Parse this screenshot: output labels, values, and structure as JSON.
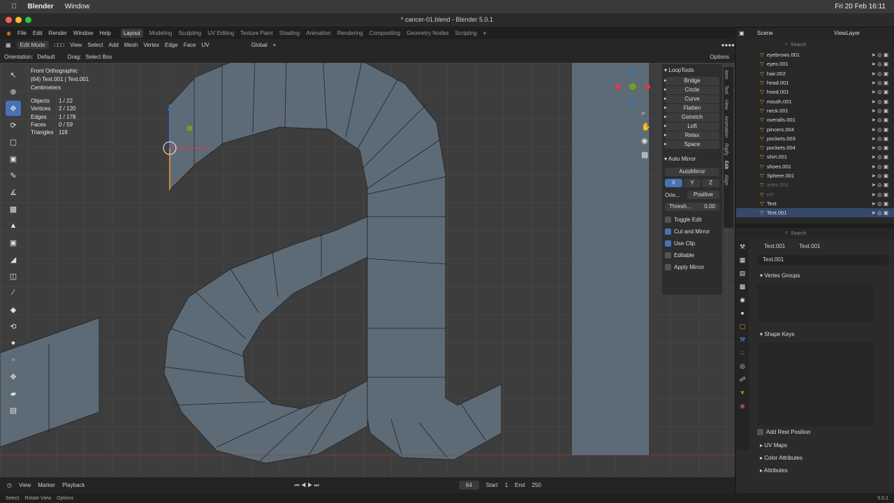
{
  "mac_menu": {
    "app": "Blender",
    "window": "Window",
    "clock": "Fri 20 Feb 16:11"
  },
  "title": "* cancer-01.blend - Blender 5.0.1",
  "menus": [
    "File",
    "Edit",
    "Render",
    "Window",
    "Help"
  ],
  "workspaces": [
    "Layout",
    "Modeling",
    "Sculpting",
    "UV Editing",
    "Texture Paint",
    "Shading",
    "Animation",
    "Rendering",
    "Compositing",
    "Geometry Nodes",
    "Scripting"
  ],
  "active_workspace": "Layout",
  "viewport_header": {
    "mode": "Edit Mode",
    "menus": [
      "View",
      "Select",
      "Add",
      "Mesh",
      "Vertex",
      "Edge",
      "Face",
      "UV"
    ],
    "transform": "Global",
    "options": "Options"
  },
  "tool_header": {
    "orientation_label": "Orientation:",
    "orientation": "Default",
    "drag_label": "Drag:",
    "drag": "Select Box"
  },
  "overlay": {
    "view": "Front Orthographic",
    "object": "(64) Text.001 | Text.001",
    "units": "Centimeters"
  },
  "stats": [
    {
      "k": "Objects",
      "v": "1 / 22"
    },
    {
      "k": "Vertices",
      "v": "2 / 120"
    },
    {
      "k": "Edges",
      "v": "1 / 178"
    },
    {
      "k": "Faces",
      "v": "0 / 59"
    },
    {
      "k": "Triangles",
      "v": "118"
    }
  ],
  "looptools": {
    "title": "LoopTools",
    "buttons": [
      "Bridge",
      "Circle",
      "Curve",
      "Flatten",
      "Gstretch",
      "Loft",
      "Relax",
      "Space"
    ]
  },
  "automirror": {
    "title": "Auto Mirror",
    "button": "AutoMirror",
    "axes": [
      "X",
      "Y",
      "Z"
    ],
    "orientation_label": "Orie...",
    "orientation": "Positive",
    "threshold_label": "Thresh...",
    "threshold": "0.00",
    "options": [
      {
        "label": "Toggle Edit",
        "checked": false
      },
      {
        "label": "Cut and Mirror",
        "checked": true
      },
      {
        "label": "Use Clip",
        "checked": true
      },
      {
        "label": "Editable",
        "checked": false
      },
      {
        "label": "Apply Mirror",
        "checked": false
      }
    ]
  },
  "side_tabs": [
    "Item",
    "Tool",
    "View",
    "Animation",
    "Rigify",
    "Edit",
    "Align"
  ],
  "outliner": {
    "header": "Scene",
    "viewlayer": "ViewLayer",
    "search_placeholder": "Search",
    "items": [
      {
        "name": "eyebrows.001",
        "dim": false,
        "sel": false
      },
      {
        "name": "eyes.001",
        "dim": false,
        "sel": false
      },
      {
        "name": "hair.002",
        "dim": false,
        "sel": false
      },
      {
        "name": "head.001",
        "dim": false,
        "sel": false
      },
      {
        "name": "hood.001",
        "dim": false,
        "sel": false
      },
      {
        "name": "mouth.001",
        "dim": false,
        "sel": false
      },
      {
        "name": "neck.001",
        "dim": false,
        "sel": false
      },
      {
        "name": "overalls.001",
        "dim": false,
        "sel": false
      },
      {
        "name": "pincers.004",
        "dim": false,
        "sel": false
      },
      {
        "name": "pockets.003",
        "dim": false,
        "sel": false
      },
      {
        "name": "pockets.004",
        "dim": false,
        "sel": false
      },
      {
        "name": "shirt.001",
        "dim": false,
        "sel": false
      },
      {
        "name": "shoes.001",
        "dim": false,
        "sel": false
      },
      {
        "name": "Sphere.001",
        "dim": false,
        "sel": false
      },
      {
        "name": "aries.001",
        "dim": true,
        "sel": false
      },
      {
        "name": "ref",
        "dim": true,
        "sel": false
      },
      {
        "name": "Text",
        "dim": false,
        "sel": false
      },
      {
        "name": "Text.001",
        "dim": false,
        "sel": true
      }
    ]
  },
  "properties": {
    "search_placeholder": "Search",
    "object": "Text.001",
    "data": "Text.001",
    "mesh_name": "Text.001",
    "sections": [
      "Vertex Groups",
      "Shape Keys",
      "UV Maps",
      "Color Attributes",
      "Attributes"
    ],
    "add_rest": "Add Rest Position"
  },
  "timeline": {
    "menus": [
      "View",
      "Marker",
      "Playback"
    ],
    "frame": "64",
    "start_label": "Start",
    "start": "1",
    "end_label": "End",
    "end": "250"
  },
  "statusbar": {
    "items": [
      "Select",
      "Rotate View",
      "Options"
    ],
    "version": "5.0.1"
  },
  "colors": {
    "accent": "#4772b3",
    "mesh": "#5d6b77",
    "edge": "#1a1a1a",
    "xaxis": "#d0404a",
    "yaxis": "#6aa31f",
    "zaxis": "#2f6fc2"
  }
}
